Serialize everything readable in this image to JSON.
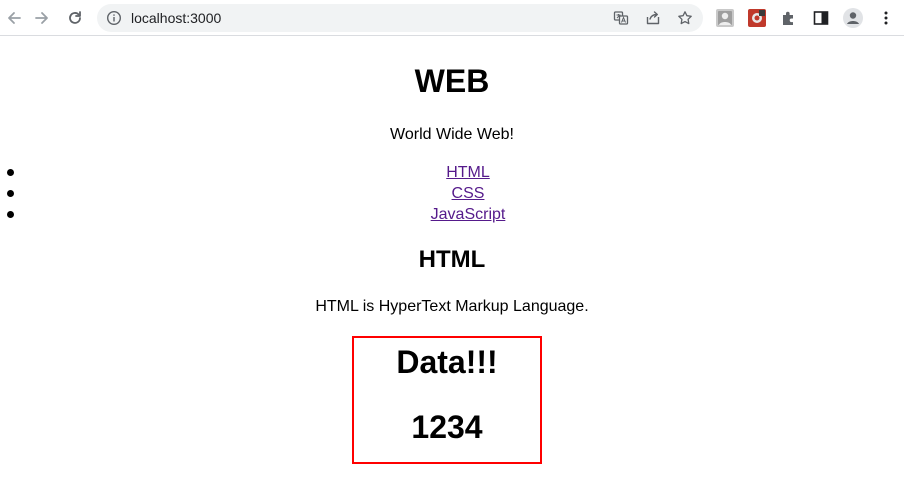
{
  "browser": {
    "url": "localhost:3000",
    "icons": {
      "back": "arrow-left-icon",
      "forward": "arrow-right-icon",
      "reload": "reload-icon",
      "site_info": "info-icon",
      "translate": "translate-icon",
      "share": "share-icon",
      "bookmark": "star-icon",
      "extension_1": "extension-avatar-icon",
      "extension_2": "extension-red-icon",
      "extensions": "puzzle-icon",
      "side_panel": "side-panel-icon",
      "profile": "profile-icon",
      "menu": "kebab-menu-icon"
    }
  },
  "page": {
    "title": "WEB",
    "subtitle": "World Wide Web!",
    "nav_links": [
      "HTML",
      "CSS",
      "JavaScript"
    ],
    "section_title": "HTML",
    "section_desc": "HTML is HyperText Markup Language.",
    "data_box": {
      "title": "Data!!!",
      "value": "1234",
      "border_color": "#ff0000"
    },
    "link_color": "#551a8b"
  }
}
